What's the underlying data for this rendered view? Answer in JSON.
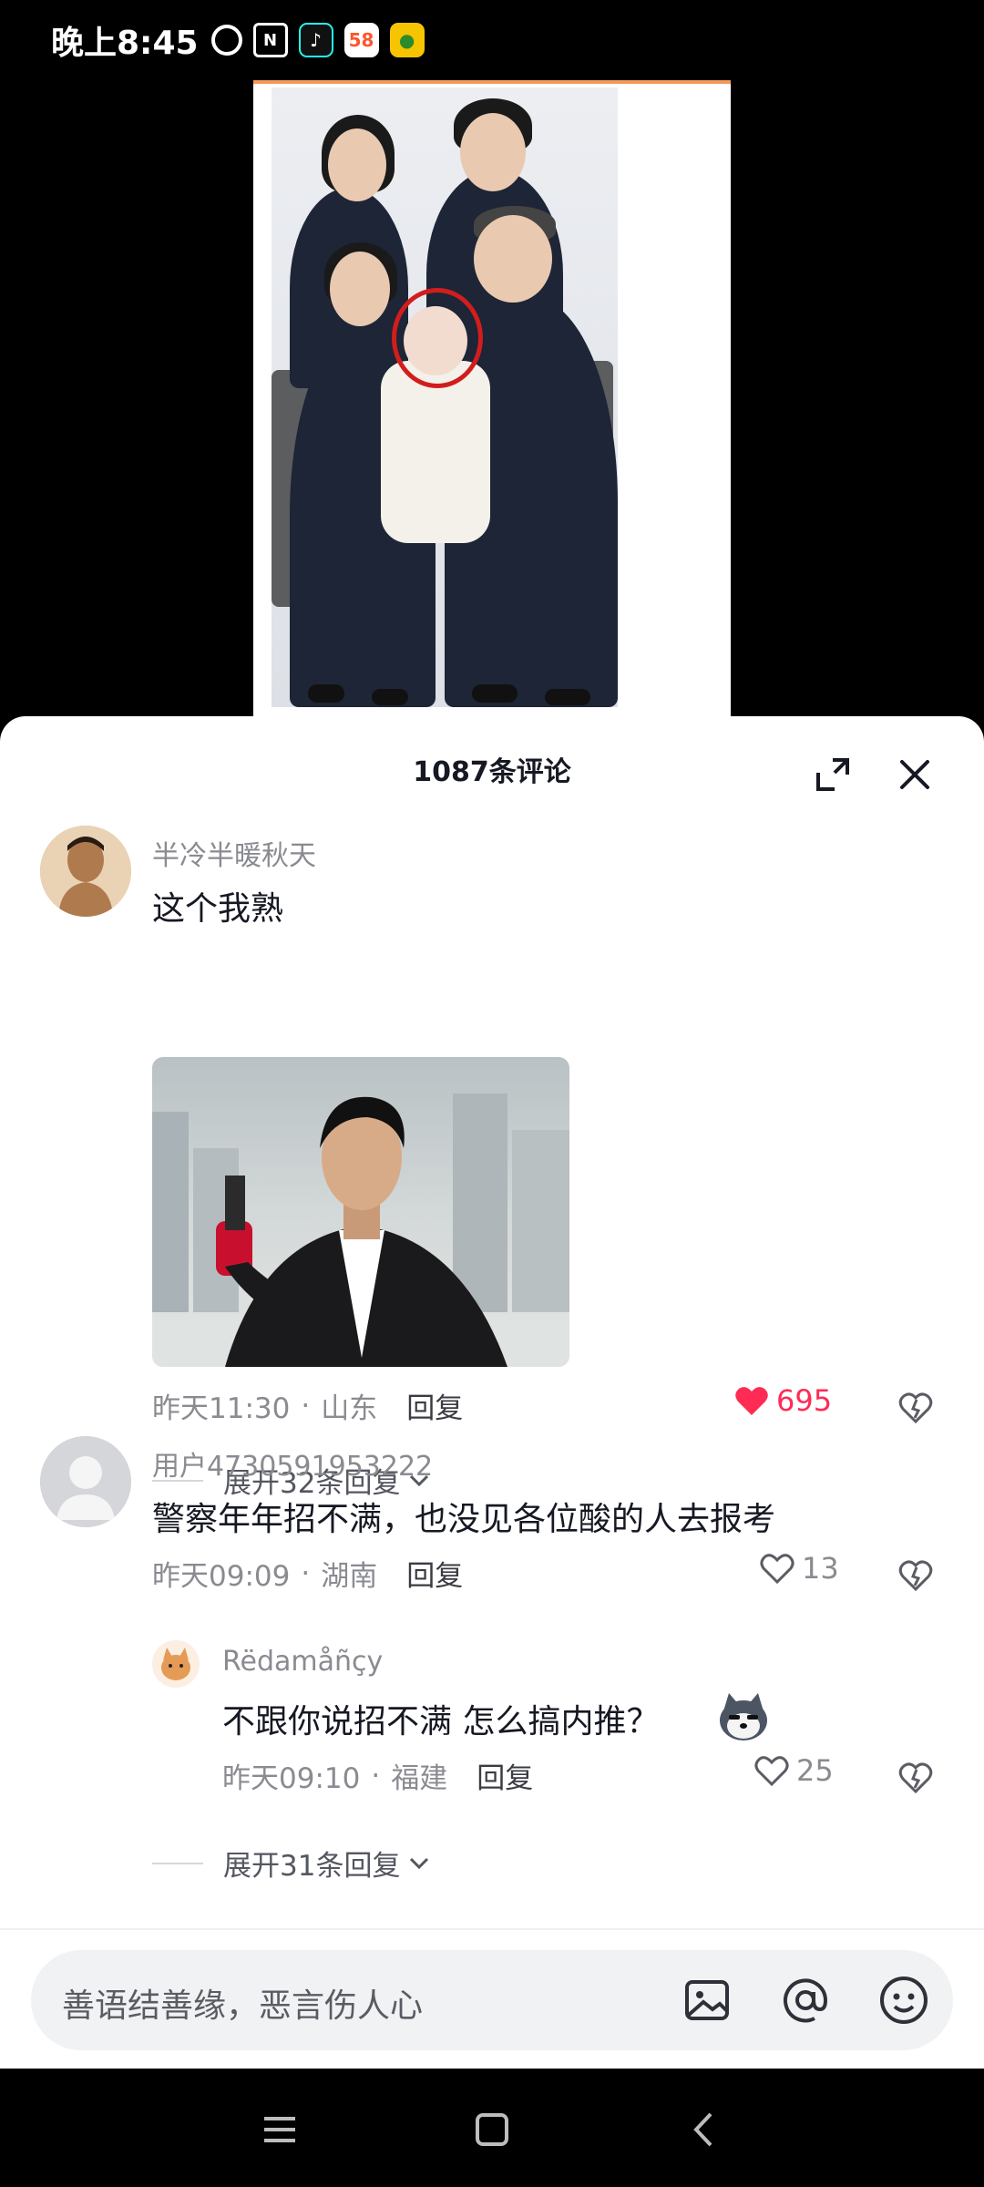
{
  "status_bar": {
    "time": "晚上8:45",
    "icons": [
      "alarm-icon",
      "nfc-icon",
      "tiktok-icon",
      "app-58-icon",
      "green-app-icon"
    ],
    "app58_label": "58"
  },
  "sheet": {
    "title": "1087条评论",
    "expand_icon": "expand-icon",
    "close_icon": "close-icon"
  },
  "comments": [
    {
      "username": "半冷半暖秋天",
      "content": "这个我熟",
      "time": "昨天11:30",
      "location": "山东",
      "reply_label": "回复",
      "likes": "695",
      "liked": true,
      "expand_label": "展开32条回复"
    },
    {
      "username": "用户4730591953222",
      "content": "警察年年招不满，也没见各位酸的人去报考",
      "time": "昨天09:09",
      "location": "湖南",
      "reply_label": "回复",
      "likes": "13",
      "liked": false
    },
    {
      "username": "Rëdamåñçy",
      "content": "不跟你说招不满 怎么搞内推？",
      "time": "昨天09:10",
      "location": "福建",
      "reply_label": "回复",
      "likes": "25",
      "liked": false,
      "expand_label": "展开31条回复"
    }
  ],
  "meta_separator": "·",
  "input": {
    "placeholder": "善语结善缘，恶言伤人心",
    "icons": [
      "image-icon",
      "at-icon",
      "emoji-icon"
    ]
  },
  "nav": {
    "icons": [
      "menu-icon",
      "home-icon",
      "back-icon"
    ]
  },
  "colors": {
    "accent": "#fe2c55",
    "muted": "#8a8b91",
    "text": "#161823"
  }
}
